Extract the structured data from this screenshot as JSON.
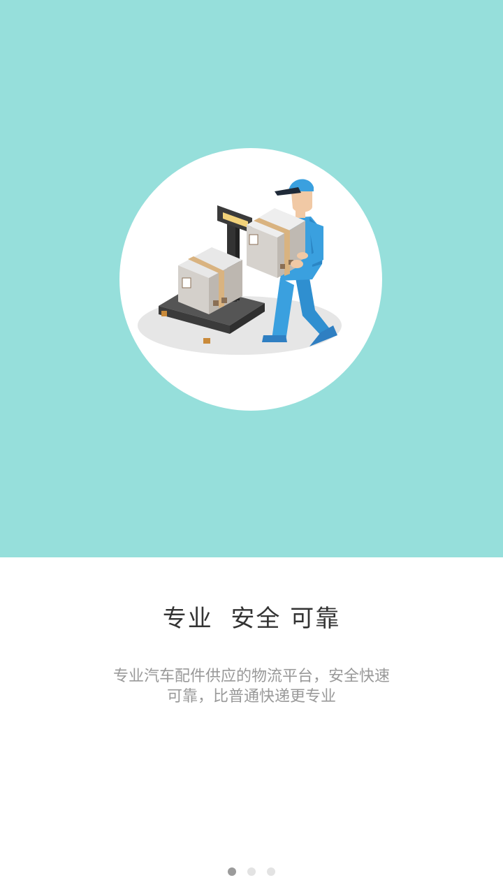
{
  "colors": {
    "hero_background": "#96dfdb",
    "title_text": "#333333",
    "description_text": "#999999",
    "dot_active": "#9b9b9b",
    "dot_inactive": "#e3e3e3"
  },
  "illustration": {
    "icon": "delivery-worker-carrying-box-scale-illustration"
  },
  "onboarding": {
    "title": "专业  安全 可靠",
    "description_line1": "专业汽车配件供应的物流平台，安全快速",
    "description_line2": "可靠，比普通快递更专业"
  },
  "pager": {
    "page_count": 3,
    "current_page": 1
  }
}
